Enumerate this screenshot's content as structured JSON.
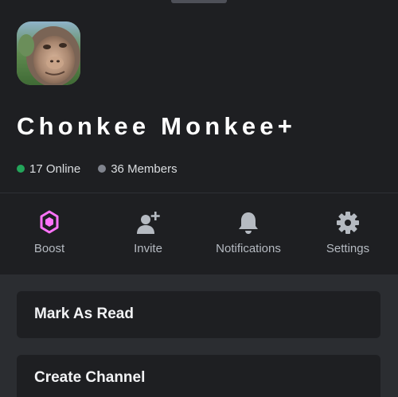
{
  "server": {
    "name": "Chonkee Monkee+",
    "avatar_icon": "server-avatar-monkey",
    "online_count": "17 Online",
    "members_count": "36 Members"
  },
  "colors": {
    "online": "#23a55a",
    "offline": "#80848e",
    "boost": "#ff73fa"
  },
  "actions": [
    {
      "label": "Boost",
      "icon": "boost-gem-icon"
    },
    {
      "label": "Invite",
      "icon": "add-user-icon"
    },
    {
      "label": "Notifications",
      "icon": "bell-icon"
    },
    {
      "label": "Settings",
      "icon": "gear-icon"
    }
  ],
  "menu": [
    {
      "label": "Mark As Read"
    },
    {
      "label": "Create Channel"
    }
  ]
}
